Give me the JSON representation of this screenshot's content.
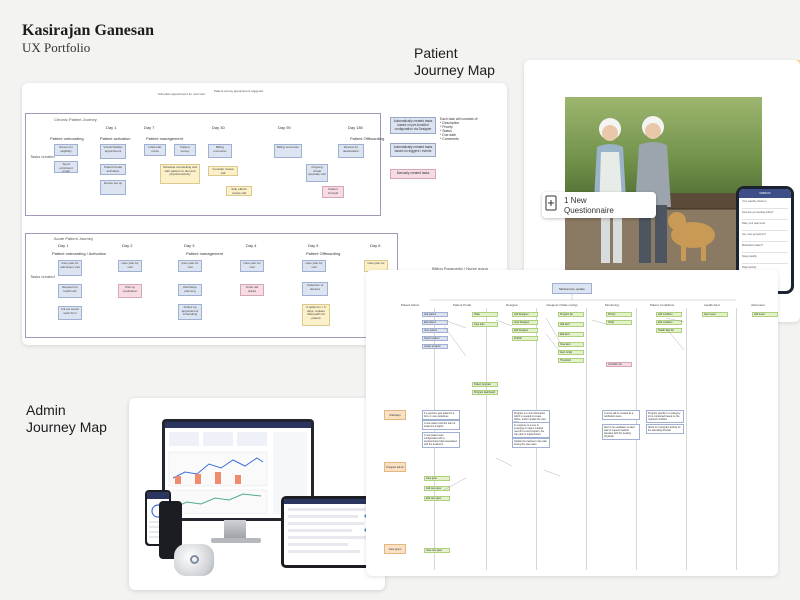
{
  "header": {
    "author": "Kasirajan Ganesan",
    "role": "UX Portfolio"
  },
  "sections": {
    "patient_journey": {
      "line1": "Patient",
      "line2": "Journey Map"
    },
    "admin_journey": {
      "line1": "Admin",
      "line2": "Journey Map"
    }
  },
  "journey_map": {
    "chronic": {
      "label": "Chronic Patient Journey",
      "columns": [
        "Day 1",
        "Day 7",
        "Day 30",
        "Day 90",
        "Day 180"
      ],
      "stages": [
        "Patient onboarding",
        "Patient activation",
        "Patient management",
        "Patient Offboarding"
      ],
      "row_label": "Tasks created",
      "notes": [
        {
          "text": "Screen for eligibility",
          "color": "blue"
        },
        {
          "text": "Send enrolment email",
          "color": "blue"
        },
        {
          "text": "Virtual bladder appointment",
          "color": "blue"
        },
        {
          "text": "Patient Kudel activation",
          "color": "blue"
        },
        {
          "text": "Device set up",
          "color": "blue"
        },
        {
          "text": "Initial call: nurse",
          "color": "blue"
        },
        {
          "text": "Patient survey",
          "color": "blue"
        },
        {
          "text": "Schedule counselling visit with patient on diet and physical activity",
          "color": "yellow"
        },
        {
          "text": "Billing encounter",
          "color": "blue"
        },
        {
          "text": "Consider review call",
          "color": "yellow"
        },
        {
          "text": "Side effects review call",
          "color": "yellow"
        },
        {
          "text": "Billing encounter",
          "color": "blue"
        },
        {
          "text": "Ongoing virtual specialty visit",
          "color": "blue"
        },
        {
          "text": "Patient Consult",
          "color": "pink"
        },
        {
          "text": "Review for deactivation",
          "color": "blue"
        }
      ]
    },
    "acute": {
      "label": "Acute Patient Journey",
      "columns": [
        "Day 1",
        "Day 2",
        "Day 3",
        "Day 4",
        "Day 5",
        "Day 6"
      ],
      "stages": [
        "Patient onboarding / Activation",
        "Patient management",
        "Patient Offboarding"
      ],
      "row_label": "Tasks created",
      "notes": [
        {
          "text": "Care plan for admission visit",
          "color": "blue"
        },
        {
          "text": "Request for health attr",
          "color": "blue"
        },
        {
          "text": "Fill out social work form",
          "color": "blue"
        },
        {
          "text": "Care plan for visit",
          "color": "blue"
        },
        {
          "text": "Pick up medication",
          "color": "pink"
        },
        {
          "text": "Care plan for visit",
          "color": "blue"
        },
        {
          "text": "Discharge planning",
          "color": "blue"
        },
        {
          "text": "Follow up appointment scheduling",
          "color": "blue"
        },
        {
          "text": "Care plan for visit",
          "color": "blue"
        },
        {
          "text": "Order lab draws",
          "color": "pink"
        },
        {
          "text": "Care plan for visit",
          "color": "blue"
        },
        {
          "text": "Collection of devices",
          "color": "blue"
        },
        {
          "text": "If patient is > 5 days, replace Vital patch for patient",
          "color": "yellow"
        },
        {
          "text": "Care plan for",
          "color": "yellow"
        }
      ]
    },
    "side_notes": {
      "legend": "Each task will consists of\n* Description\n* Priority\n* Status\n* Due date\n* Comments",
      "boxes": [
        {
          "text": "Automatically created tasks based on pre-bundled configuration via Designer",
          "color": "blue"
        },
        {
          "text": "Automatically created tasks based on triggers / events",
          "color": "blue"
        },
        {
          "text": "Manually created tasks",
          "color": "pink"
        }
      ],
      "annotations": [
        "Schedule appointment for next visit",
        "Patient survey appointment triggered"
      ],
      "cut_label": "Billing Paramedic / Nurse going"
    }
  },
  "patient_photo": {
    "badge_text": "1 New\nQuestionnaire",
    "badge_icon": "add-document-icon",
    "phone_header": "MIMIOS",
    "phone_subtitle": "Your weekly check-in",
    "phone_items": [
      "How are you feeling today?",
      "Rate your pain level",
      "Any new symptoms?",
      "Medication taken?",
      "Sleep quality",
      "Daily activity"
    ]
  },
  "flow_chart": {
    "title": "Multiservice update",
    "lanes": [
      "Patient Admin",
      "Patient Portal",
      "Designer",
      "Designer (Vitals config)",
      "Monitoring",
      "Patient Conditions",
      "Health Alert",
      "Alertmeter"
    ],
    "stages": [
      "Pathways",
      "Program admin",
      "Care given"
    ],
    "notes": [
      "If a question gets added to a form or care guidelines",
      "A new patient with the start of treatment program",
      "A new patient care configuration with a predetermined plan associated with the treatment",
      "Program is a new information which is needed to create, define, and/or update the care plan",
      "In response to a new or emerging or urgent medical need for a new program, the care plan is implemented",
      "Update the treatment care plan among the care team",
      "A nurse will be created as a notification team",
      "Alert to an escalation on alert task to request medical attention with the treating physician",
      "Program specific to a category to be conducted based on the reported condition",
      "Alerts for a program activity for the attending clinician"
    ],
    "nodes": [
      "Add patient",
      "Edit patient",
      "View patient",
      "Search patient",
      "Assign program",
      "Vitals",
      "Care plan",
      "Add Designer",
      "View Designer",
      "Edit Designer",
      "Publish",
      "Patient program",
      "Program dashboard",
      "Program list",
      "Add alert",
      "Edit alert",
      "View alert",
      "Alert config",
      "Threshold",
      "Priority",
      "Notify",
      "Condition list",
      "Add condition",
      "Edit condition",
      "Health alert list",
      "Alert meter",
      "Add meter",
      "Care giver",
      "Add care giver",
      "Edit care giver",
      "View care giver"
    ]
  },
  "admin_devices": {
    "dashboard_title": "Dashboards",
    "tablet_title": "Patient Overview"
  }
}
